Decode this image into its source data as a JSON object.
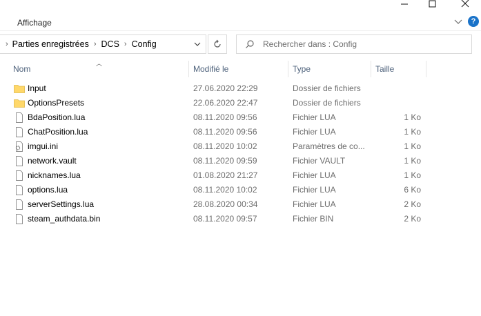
{
  "window": {
    "minimize_icon": "minimize-icon",
    "maximize_icon": "maximize-icon",
    "close_icon": "close-icon"
  },
  "ribbon": {
    "tab_label": "Affichage",
    "expand_icon": "chevron-down-icon",
    "help_icon": "help-icon",
    "help_glyph": "?"
  },
  "address": {
    "crumbs": [
      "Parties enregistrées",
      "DCS",
      "Config"
    ],
    "separator": "›",
    "refresh_icon": "refresh-icon"
  },
  "search": {
    "placeholder": "Rechercher dans : Config",
    "icon": "search-icon"
  },
  "columns": {
    "name": "Nom",
    "modified": "Modifié le",
    "type": "Type",
    "size": "Taille"
  },
  "files": [
    {
      "name": "Input",
      "modified": "27.06.2020 22:29",
      "type": "Dossier de fichiers",
      "size": "",
      "icon": "folder-icon"
    },
    {
      "name": "OptionsPresets",
      "modified": "22.06.2020 22:47",
      "type": "Dossier de fichiers",
      "size": "",
      "icon": "folder-icon"
    },
    {
      "name": "BdaPosition.lua",
      "modified": "08.11.2020 09:56",
      "type": "Fichier LUA",
      "size": "1 Ko",
      "icon": "file-icon"
    },
    {
      "name": "ChatPosition.lua",
      "modified": "08.11.2020 09:56",
      "type": "Fichier LUA",
      "size": "1 Ko",
      "icon": "file-icon"
    },
    {
      "name": "imgui.ini",
      "modified": "08.11.2020 10:02",
      "type": "Paramètres de co...",
      "size": "1 Ko",
      "icon": "settings-file-icon"
    },
    {
      "name": "network.vault",
      "modified": "08.11.2020 09:59",
      "type": "Fichier VAULT",
      "size": "1 Ko",
      "icon": "file-icon"
    },
    {
      "name": "nicknames.lua",
      "modified": "01.08.2020 21:27",
      "type": "Fichier LUA",
      "size": "1 Ko",
      "icon": "file-icon"
    },
    {
      "name": "options.lua",
      "modified": "08.11.2020 10:02",
      "type": "Fichier LUA",
      "size": "6 Ko",
      "icon": "file-icon"
    },
    {
      "name": "serverSettings.lua",
      "modified": "28.08.2020 00:34",
      "type": "Fichier LUA",
      "size": "2 Ko",
      "icon": "file-icon"
    },
    {
      "name": "steam_authdata.bin",
      "modified": "08.11.2020 09:57",
      "type": "Fichier BIN",
      "size": "2 Ko",
      "icon": "file-icon"
    }
  ],
  "colors": {
    "folder": "#ffd86a",
    "header_text": "#4c607a",
    "muted_text": "#6d6d6d"
  }
}
